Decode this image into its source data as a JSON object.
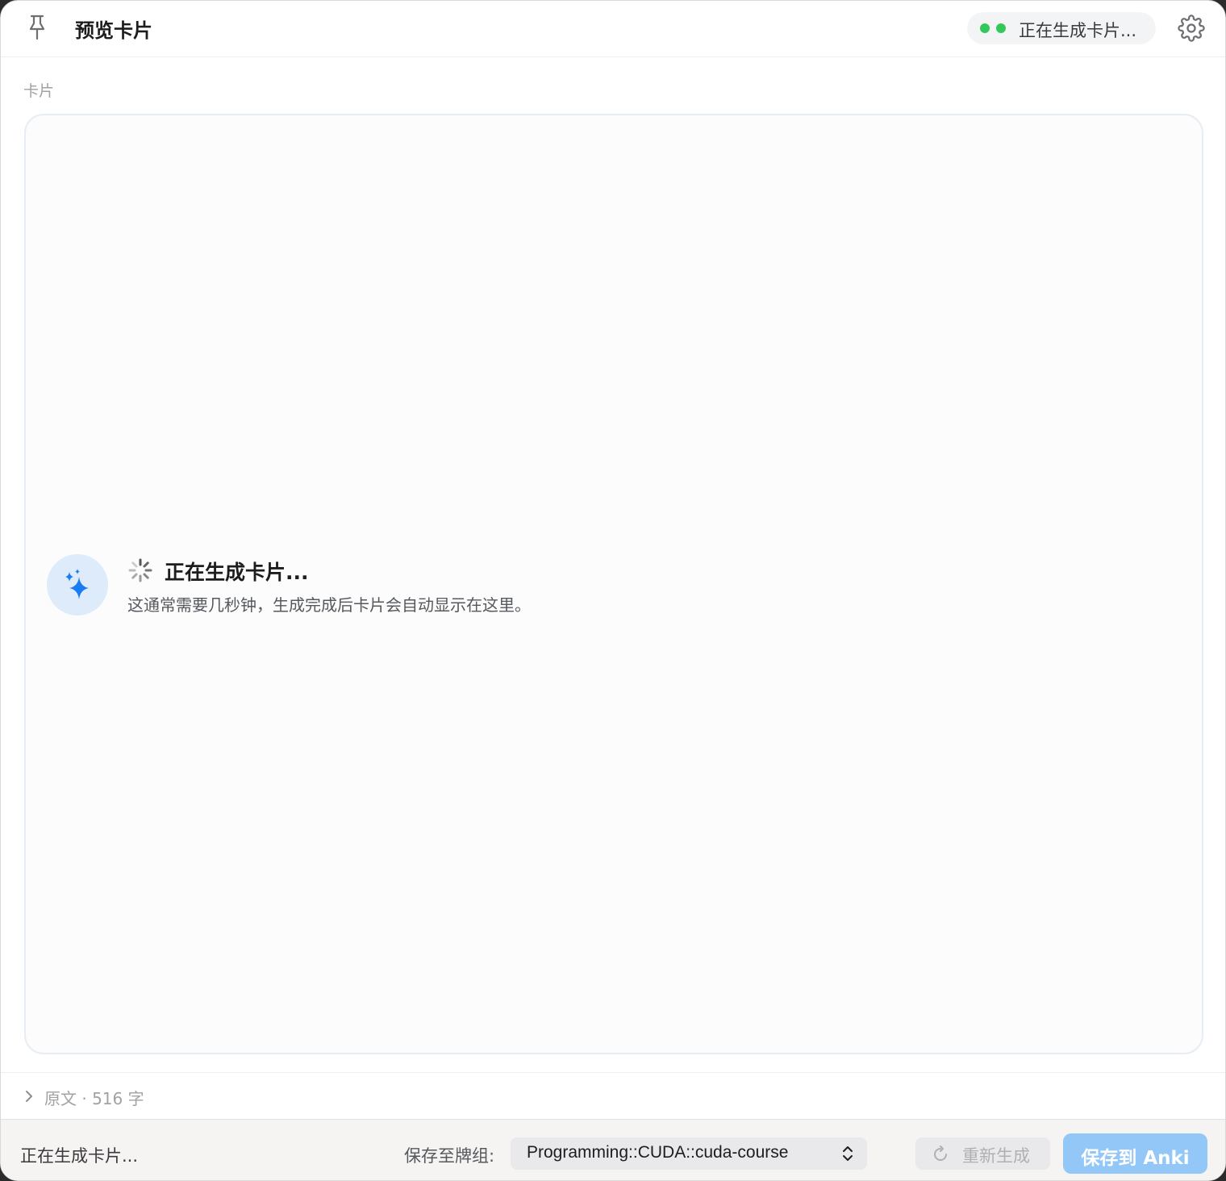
{
  "header": {
    "title": "预览卡片",
    "status_text": "正在生成卡片...",
    "status_color": "#34c759",
    "icons": {
      "pin": "pin-icon",
      "settings": "gear-icon"
    }
  },
  "section": {
    "label": "卡片"
  },
  "loading": {
    "title": "正在生成卡片...",
    "subtitle": "这通常需要几秒钟，生成完成后卡片会自动显示在这里。",
    "accent_color": "#1a7cf2",
    "icons": {
      "badge": "sparkles-icon",
      "spinner": "spinner-icon"
    }
  },
  "original": {
    "label": "原文 · 516 字"
  },
  "footer": {
    "status_text": "正在生成卡片...",
    "deck_label": "保存至牌组:",
    "deck_value": "Programming::CUDA::cuda-course",
    "regenerate_label": "重新生成",
    "save_label": "保存到 Anki",
    "save_color": "#93c7f7"
  }
}
